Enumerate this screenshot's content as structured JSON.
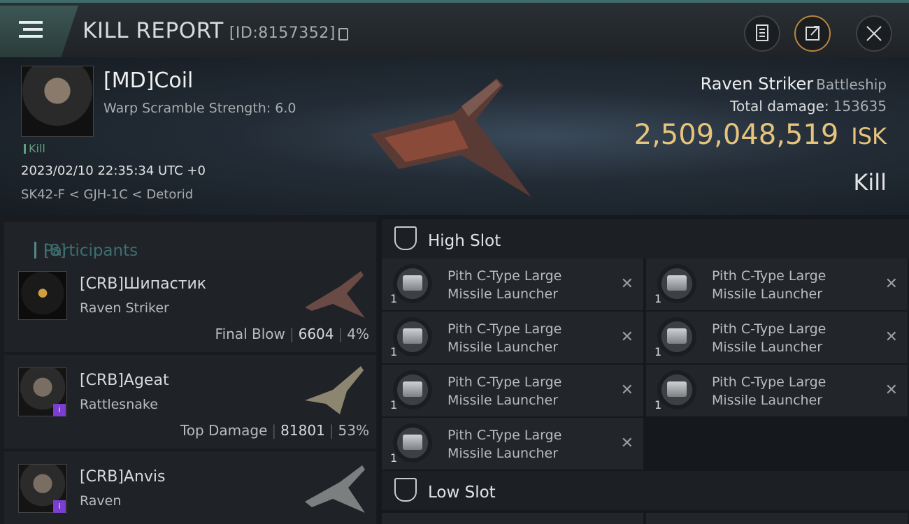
{
  "header": {
    "title": "KILL REPORT",
    "report_id": "[ID:8157352]",
    "buttons": [
      "clipboard-icon",
      "export-icon",
      "close-icon"
    ]
  },
  "victim": {
    "name": "[MD]Coil",
    "warp_scramble": "Warp Scramble Strength: 6.0",
    "tag": "Kill",
    "datetime": "2023/02/10 22:35:34 UTC +0",
    "location": "SK42-F < GJH-1C < Detorid",
    "ship_name": "Raven Striker",
    "ship_class": "Battleship",
    "total_damage_label": "Total damage:",
    "total_damage": "153635",
    "isk_value": "2,509,048,519",
    "isk_unit": "ISK",
    "result": "Kill"
  },
  "participants": {
    "label": "Participants",
    "count": "[8]",
    "items": [
      {
        "name": "[CRB]Шипастик",
        "ship": "Raven Striker",
        "role": "Final Blow",
        "damage": "6604",
        "pct": "4%"
      },
      {
        "name": "[CRB]Ageat",
        "ship": "Rattlesnake",
        "role": "Top Damage",
        "damage": "81801",
        "pct": "53%"
      },
      {
        "name": "[CRB]Anvis",
        "ship": "Raven",
        "role": "",
        "damage": "",
        "pct": ""
      }
    ]
  },
  "slots": {
    "high_label": "High Slot",
    "low_label": "Low Slot",
    "module_line1": "Pith C-Type Large",
    "module_line2": "Missile Launcher",
    "qty": "1"
  }
}
